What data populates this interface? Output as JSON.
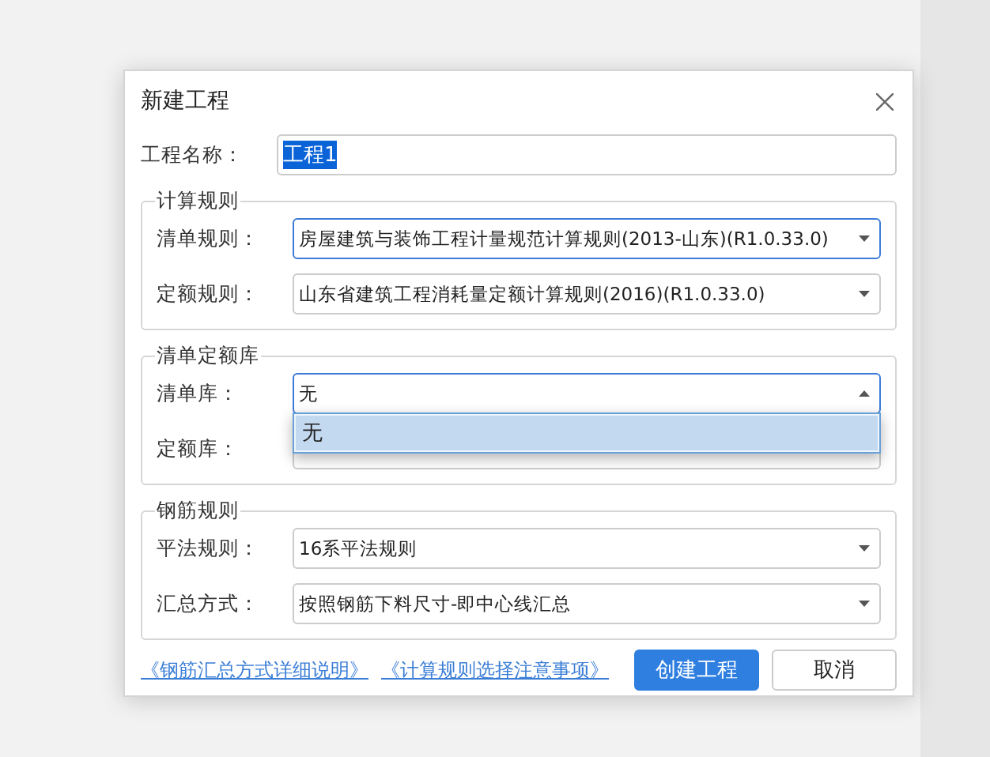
{
  "dialog": {
    "title": "新建工程",
    "name_field": {
      "label": "工程名称：",
      "value": "工程1",
      "text_selected": true
    },
    "groups": [
      {
        "title": "计算规则",
        "rows": [
          {
            "label": "清单规则：",
            "value": "房屋建筑与装饰工程计量规范计算规则(2013-山东)(R1.0.33.0)",
            "focused": true,
            "expanded": false
          },
          {
            "label": "定额规则：",
            "value": "山东省建筑工程消耗量定额计算规则(2016)(R1.0.33.0)",
            "focused": false,
            "expanded": false
          }
        ]
      },
      {
        "title": "清单定额库",
        "rows": [
          {
            "label": "清单库：",
            "value": "无",
            "focused": true,
            "expanded": true,
            "options": [
              {
                "label": "无",
                "selected": true
              }
            ]
          },
          {
            "label": "定额库：",
            "focused": false
          }
        ]
      },
      {
        "title": "钢筋规则",
        "rows": [
          {
            "label": "平法规则：",
            "value": "16系平法规则",
            "focused": false,
            "expanded": false
          },
          {
            "label": "汇总方式：",
            "value": "按照钢筋下料尺寸-即中心线汇总",
            "focused": false,
            "expanded": false
          }
        ]
      }
    ],
    "links": [
      "《钢筋汇总方式详细说明》",
      "《计算规则选择注意事项》"
    ],
    "buttons": [
      {
        "label": "创建工程",
        "kind": "primary"
      },
      {
        "label": "取消",
        "kind": "secondary"
      }
    ]
  }
}
